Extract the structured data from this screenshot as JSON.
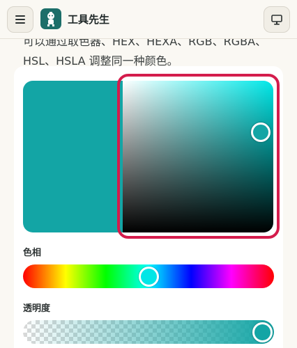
{
  "header": {
    "title": "工具先生",
    "menu_icon": "hamburger-menu-icon",
    "logo_icon": "mascot-logo-icon",
    "device_icon": "monitor-icon"
  },
  "description": {
    "line1": "可以通过取色器、HEX、HEXA、RGB、RGBA、",
    "line2": "HSL、HSLA 调整同一种颜色。"
  },
  "picker": {
    "current_color": "#13a5a5",
    "hue_color": "#00e8e8",
    "highlight_color": "#d41c4c",
    "hue_label": "色相",
    "hue_position": 0.5,
    "alpha_label": "透明度",
    "alpha_value": 1.0
  }
}
